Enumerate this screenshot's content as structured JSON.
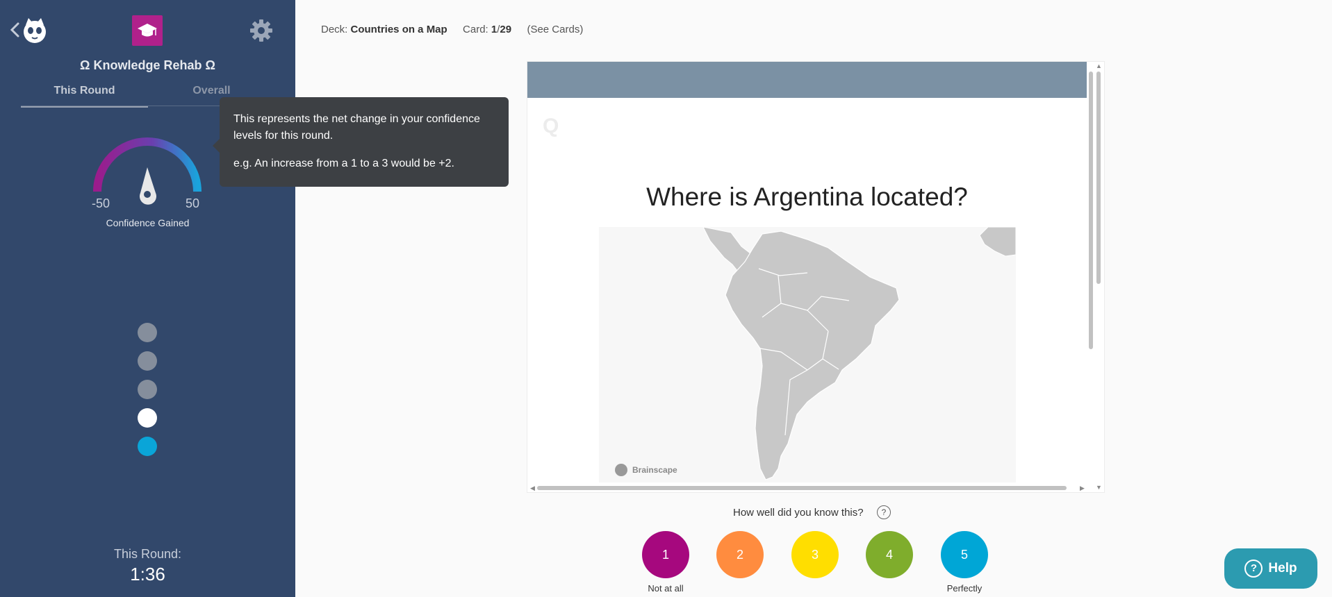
{
  "sidebar": {
    "title": "Ω Knowledge Rehab Ω",
    "tabs": [
      {
        "label": "This Round",
        "active": true
      },
      {
        "label": "Overall",
        "active": false
      }
    ],
    "gauge": {
      "min_label": "-50",
      "max_label": "50",
      "caption": "Confidence Gained",
      "value_fraction": 0.5
    },
    "progress_dots": [
      "grey",
      "grey",
      "grey",
      "white",
      "blue"
    ],
    "round": {
      "label": "This Round:",
      "time": "1:36"
    },
    "colors": {
      "background": "#32486b",
      "deck_icon": "#b0218b"
    },
    "icons": {
      "back": "chevron-left-icon",
      "logo": "brainscape-logo-icon",
      "deck": "graduation-cap-icon",
      "settings": "gear-icon"
    }
  },
  "tooltip": {
    "line1": "This represents the net change in your confidence levels for this round.",
    "line2": "e.g. An increase from a 1 to a 3 would be +2."
  },
  "top_info": {
    "deck_label": "Deck:",
    "deck_name": "Countries on a Map",
    "card_label": "Card:",
    "card_current": "1",
    "card_sep": "/",
    "card_total": "29",
    "see_cards": "(See Cards)"
  },
  "card": {
    "q_mark": "Q",
    "question": "Where is Argentina located?",
    "map_watermark": "Brainscape",
    "header_color": "#7b91a4"
  },
  "rating": {
    "prompt": "How well did you know this?",
    "help_glyph": "?",
    "buttons": [
      {
        "label": "1",
        "color": "#a6087e"
      },
      {
        "label": "2",
        "color": "#ff8c3f"
      },
      {
        "label": "3",
        "color": "#ffde00"
      },
      {
        "label": "4",
        "color": "#7fad2c"
      },
      {
        "label": "5",
        "color": "#00a6d6"
      }
    ],
    "low_label": "Not at all",
    "high_label": "Perfectly"
  },
  "help_button": {
    "label": "Help",
    "glyph": "?",
    "color": "#2c9bb0"
  }
}
